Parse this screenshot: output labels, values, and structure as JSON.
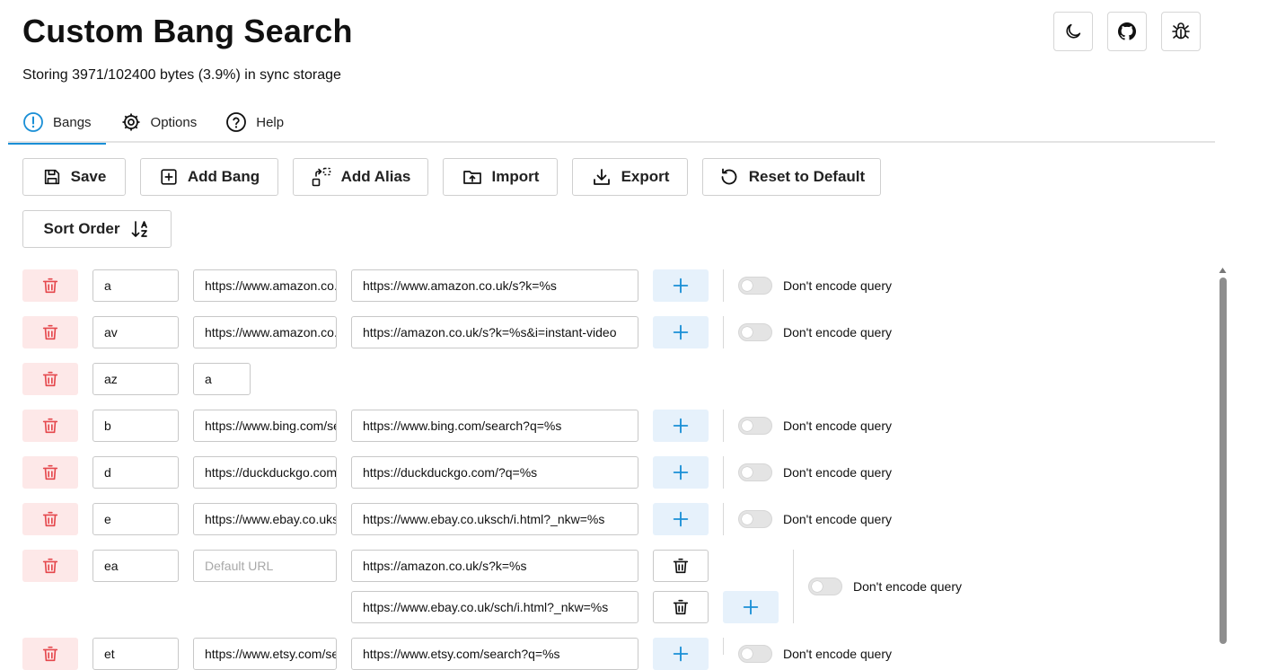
{
  "header": {
    "title": "Custom Bang Search",
    "storage": "Storing 3971/102400 bytes (3.9%) in sync storage",
    "icons": [
      "moon-icon",
      "github-icon",
      "bug-icon"
    ]
  },
  "tabs": [
    {
      "label": "Bangs",
      "icon": "exclamation-circle-icon",
      "active": true
    },
    {
      "label": "Options",
      "icon": "gear-icon",
      "active": false
    },
    {
      "label": "Help",
      "icon": "question-circle-icon",
      "active": false
    }
  ],
  "toolbar": {
    "save": "Save",
    "add_bang": "Add Bang",
    "add_alias": "Add Alias",
    "import": "Import",
    "export": "Export",
    "reset": "Reset to Default",
    "sort_order": "Sort Order"
  },
  "bangs": [
    {
      "bang": "a",
      "default_url": "https://www.amazon.co.uk/s?k=%s",
      "urls": [
        "https://www.amazon.co.uk/s?k=%s"
      ],
      "option": "Don't encode query"
    },
    {
      "bang": "av",
      "default_url": "https://www.amazon.co.uk/s?k=%s&i=instant-video",
      "urls": [
        "https://amazon.co.uk/s?k=%s&i=instant-video"
      ],
      "option": "Don't encode query"
    },
    {
      "bang": "az",
      "alias_of": "a"
    },
    {
      "bang": "b",
      "default_url": "https://www.bing.com/search?q=%s",
      "urls": [
        "https://www.bing.com/search?q=%s"
      ],
      "option": "Don't encode query"
    },
    {
      "bang": "d",
      "default_url": "https://duckduckgo.com/?q=%s",
      "urls": [
        "https://duckduckgo.com/?q=%s"
      ],
      "option": "Don't encode query"
    },
    {
      "bang": "e",
      "default_url": "https://www.ebay.co.uksch/i.html?_nkw=%s",
      "urls": [
        "https://www.ebay.co.uksch/i.html?_nkw=%s"
      ],
      "option": "Don't encode query"
    },
    {
      "bang": "ea",
      "default_url_placeholder": "Default URL",
      "urls": [
        "https://amazon.co.uk/s?k=%s",
        "https://www.ebay.co.uk/sch/i.html?_nkw=%s"
      ],
      "option": "Don't encode query"
    },
    {
      "bang": "et",
      "default_url": "https://www.etsy.com/search?q=%s",
      "urls": [
        "https://www.etsy.com/search?q=%s"
      ],
      "option": "Don't encode query"
    }
  ],
  "colors": {
    "accent": "#1a8fd6",
    "danger": "#e5484d",
    "danger_bg": "#fde8e8",
    "accent_bg": "#e6f1fb"
  }
}
